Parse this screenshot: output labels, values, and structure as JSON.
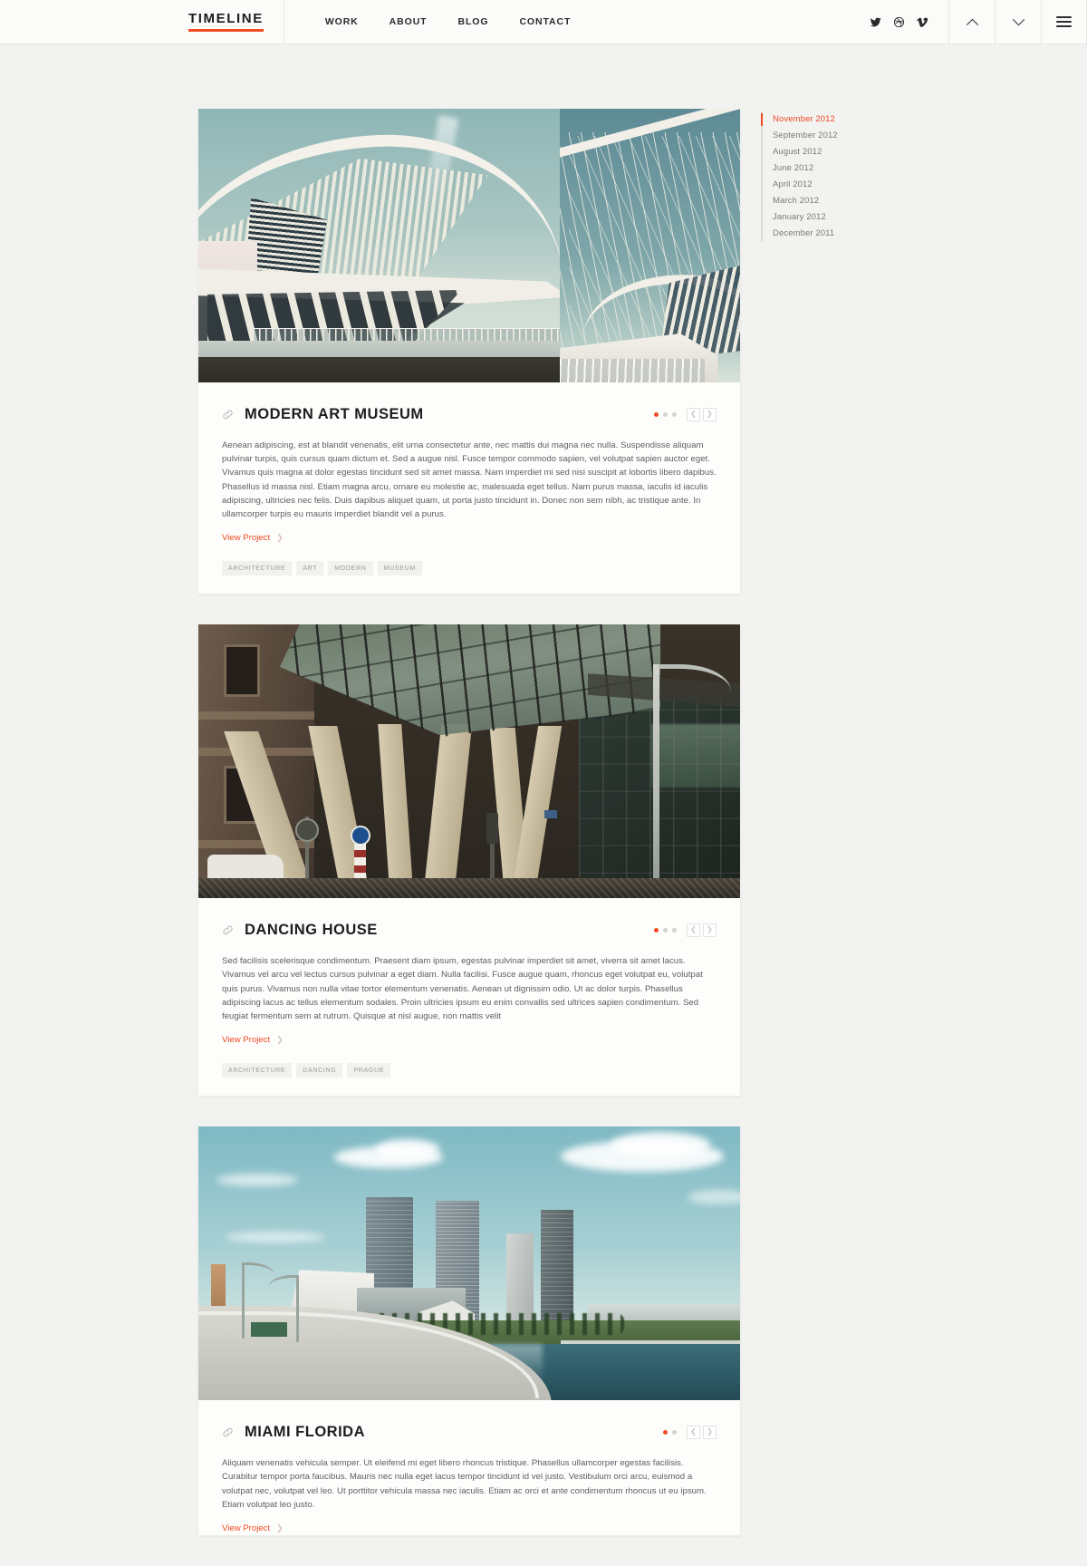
{
  "header": {
    "logo": "TIMELINE",
    "nav": [
      {
        "label": "WORK"
      },
      {
        "label": "ABOUT"
      },
      {
        "label": "BLOG"
      },
      {
        "label": "CONTACT"
      }
    ],
    "socials": [
      {
        "name": "twitter-icon"
      },
      {
        "name": "dribbble-icon"
      },
      {
        "name": "vimeo-icon"
      }
    ],
    "controls": [
      {
        "name": "scroll-up-button"
      },
      {
        "name": "scroll-down-button"
      },
      {
        "name": "menu-button"
      }
    ]
  },
  "timeline": {
    "items": [
      {
        "label": "November 2012",
        "active": true
      },
      {
        "label": "September 2012",
        "active": false
      },
      {
        "label": "August 2012",
        "active": false
      },
      {
        "label": "June 2012",
        "active": false
      },
      {
        "label": "April 2012",
        "active": false
      },
      {
        "label": "March 2012",
        "active": false
      },
      {
        "label": "January 2012",
        "active": false
      },
      {
        "label": "December 2011",
        "active": false
      }
    ]
  },
  "cards": [
    {
      "title": "MODERN ART MUSEUM",
      "body": "Aenean adipiscing, est at blandit venenatis, elit urna consectetur ante, nec mattis dui magna nec nulla. Suspendisse aliquam pulvinar turpis, quis cursus quam dictum et. Sed a augue nisl. Fusce tempor commodo sapien, vel volutpat sapien auctor eget. Vivamus quis magna at dolor egestas tincidunt sed sit amet massa. Nam imperdiet mi sed nisi suscipit at lobortis libero dapibus. Phasellus id massa nisl. Etiam magna arcu, ornare eu molestie ac, malesuada eget tellus. Nam purus massa, iaculis id iaculis adipiscing, ultricies nec felis. Duis dapibus aliquet quam, ut porta justo tincidunt in. Donec non sem nibh, ac tristique ante. In ullamcorper turpis eu mauris imperdiet blandit vel a purus.",
      "link_label": "View Project",
      "tags": [
        "ARCHITECTURE",
        "ART",
        "MODERN",
        "MUSEUM"
      ],
      "slides": 3,
      "active_slide": 1,
      "image_alt": "milwaukee-art-museum-split-photo"
    },
    {
      "title": "DANCING HOUSE",
      "body": "Sed facilisis scelerisque condimentum. Praesent diam ipsum, egestas pulvinar imperdiet sit amet, viverra sit amet lacus. Vivamus vel arcu vel lectus cursus pulvinar a eget diam. Nulla facilisi. Fusce augue quam, rhoncus eget volutpat eu, volutpat quis purus. Vivamus non nulla vitae tortor elementum venenatis. Aenean ut dignissim odio. Ut ac dolor turpis. Phasellus adipiscing lacus ac tellus elementum sodales. Proin ultricies ipsum eu enim convallis sed ultrices sapien condimentum. Sed feugiat fermentum sem at rutrum. Quisque at nisl augue, non mattis velit",
      "link_label": "View Project",
      "tags": [
        "ARCHITECTURE",
        "DANCING",
        "PRAGUE"
      ],
      "slides": 3,
      "active_slide": 1,
      "image_alt": "dancing-house-prague-photo"
    },
    {
      "title": "MIAMI FLORIDA",
      "body": "Aliquam venenatis vehicula semper. Ut eleifend mi eget libero rhoncus tristique. Phasellus ullamcorper egestas facilisis. Curabitur tempor porta faucibus. Mauris nec nulla eget lacus tempor tincidunt id vel justo. Vestibulum orci arcu, euismod a volutpat nec, volutpat vel leo. Ut porttitor vehicula massa nec iaculis. Etiam ac orci et ante condimentum rhoncus ut eu ipsum. Etiam volutpat leo justo.",
      "link_label": "View Project",
      "tags": [],
      "slides": 2,
      "active_slide": 1,
      "image_alt": "miami-florida-skyline-photo"
    }
  ],
  "colors": {
    "accent": "#f04b23",
    "page_bg": "#f2f2f0",
    "card_bg": "#fdfdfc",
    "text_dark": "#1d1d1d",
    "text_body": "#5e5e66",
    "muted": "#9b9b99"
  }
}
